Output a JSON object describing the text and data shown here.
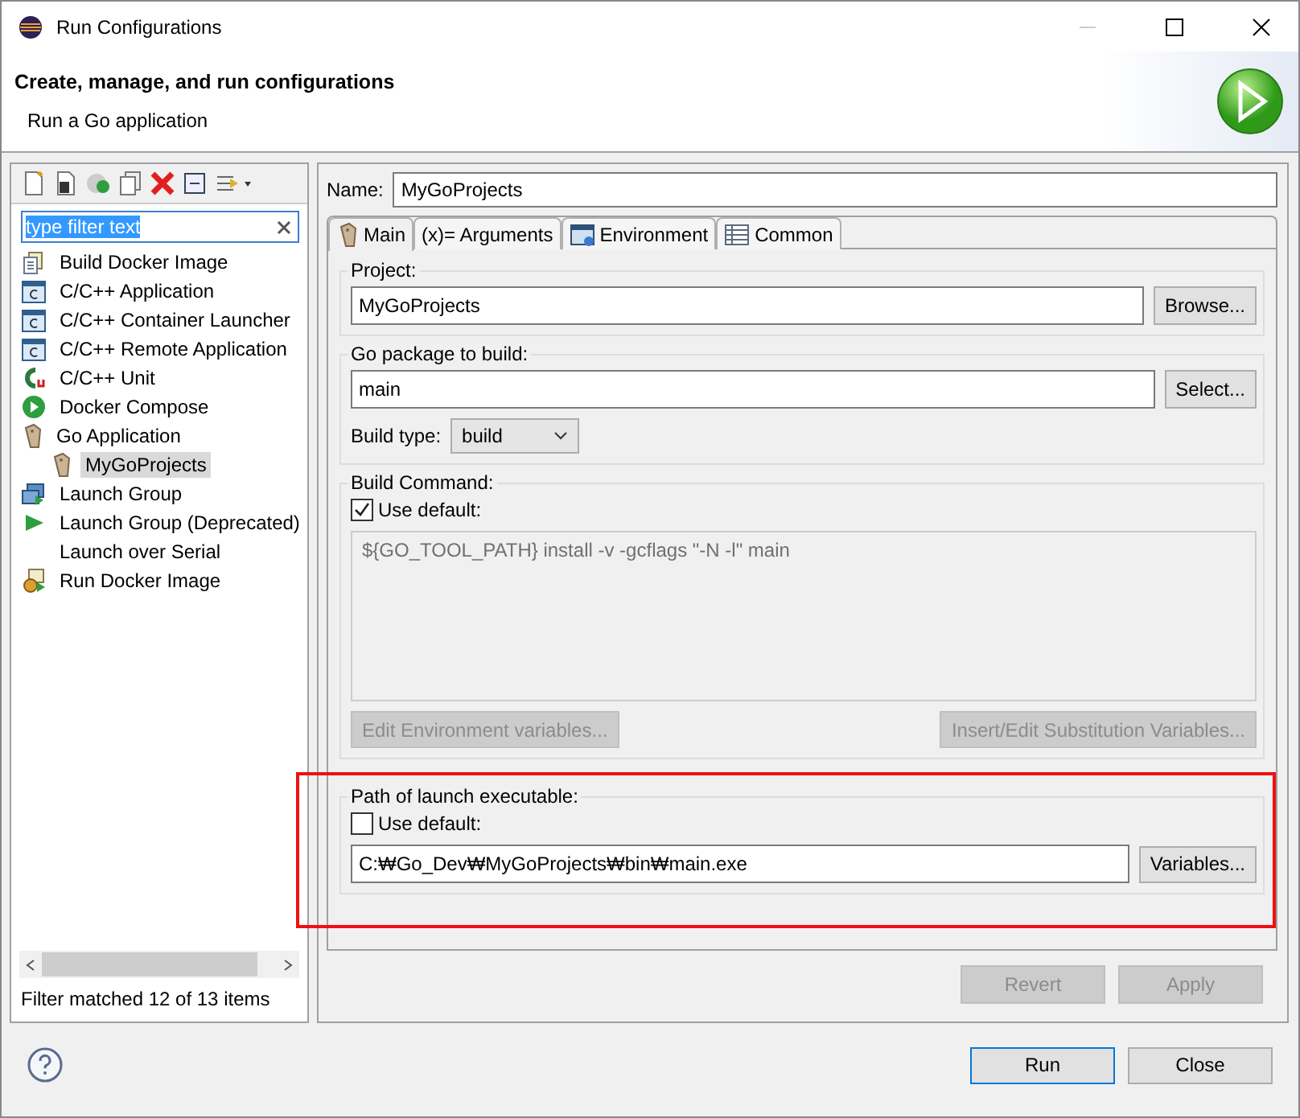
{
  "window": {
    "title": "Run Configurations"
  },
  "header": {
    "title": "Create, manage, and run configurations",
    "subtitle": "Run a Go application"
  },
  "sidebar": {
    "filter": {
      "value": "type filter text",
      "selected": true
    },
    "items": [
      {
        "label": "Build Docker Image",
        "kind": "docker-build",
        "selected": false
      },
      {
        "label": "C/C++ Application",
        "kind": "c-app",
        "selected": false
      },
      {
        "label": "C/C++ Container Launcher",
        "kind": "c-app",
        "selected": false
      },
      {
        "label": "C/C++ Remote Application",
        "kind": "c-app",
        "selected": false
      },
      {
        "label": "C/C++ Unit",
        "kind": "cunit",
        "selected": false
      },
      {
        "label": "Docker Compose",
        "kind": "compose",
        "selected": false
      },
      {
        "label": "Go Application",
        "kind": "go",
        "selected": false,
        "children": [
          {
            "label": "MyGoProjects",
            "kind": "go",
            "selected": true
          }
        ]
      },
      {
        "label": "Launch Group",
        "kind": "launch-group",
        "selected": false
      },
      {
        "label": "Launch Group (Deprecated)",
        "kind": "launch-deprecated",
        "selected": false
      },
      {
        "label": "Launch over Serial",
        "kind": "none",
        "selected": false
      },
      {
        "label": "Run Docker Image",
        "kind": "docker-run",
        "selected": false
      }
    ],
    "status": "Filter matched 12 of 13 items"
  },
  "editor": {
    "name_label": "Name:",
    "name": "MyGoProjects",
    "tabs": [
      {
        "label": "Main",
        "kind": "go",
        "selected": true
      },
      {
        "label": "(x)= Arguments",
        "kind": "none",
        "selected": false
      },
      {
        "label": "Environment",
        "kind": "env",
        "selected": false
      },
      {
        "label": "Common",
        "kind": "common",
        "selected": false
      }
    ],
    "project": {
      "label": "Project:",
      "value": "MyGoProjects",
      "button": "Browse..."
    },
    "package": {
      "label": "Go package to build:",
      "value": "main",
      "button": "Select...",
      "build_type_label": "Build type:",
      "build_type": "build"
    },
    "build_command": {
      "label": "Build Command:",
      "use_default": {
        "label": "Use default:",
        "checked": true
      },
      "command": "${GO_TOOL_PATH} install -v -gcflags \"-N -l\" main",
      "buttons": [
        {
          "label": "Edit Environment variables...",
          "disabled": true
        },
        {
          "label": "Insert/Edit Substitution Variables...",
          "disabled": true
        }
      ]
    },
    "executable": {
      "label": "Path of launch executable:",
      "use_default": {
        "label": "Use default:",
        "checked": false
      },
      "path": "C:₩Go_Dev₩MyGoProjects₩bin₩main.exe",
      "button": "Variables...",
      "highlighted": true
    },
    "actions": [
      {
        "label": "Revert",
        "disabled": true
      },
      {
        "label": "Apply",
        "disabled": true
      }
    ]
  },
  "footer": {
    "buttons": [
      {
        "label": "Run",
        "default": true
      },
      {
        "label": "Close",
        "default": false
      }
    ]
  }
}
